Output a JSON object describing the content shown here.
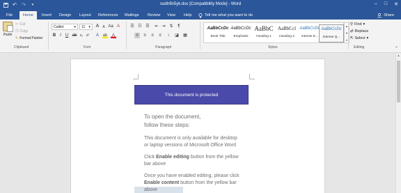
{
  "window": {
    "title": "sudtr8n5yk.doc [Compatibility Mode] - Word",
    "minimize_glyph": "–",
    "maximize_glyph": "□",
    "close_glyph": "✕"
  },
  "quick_access": {
    "save_icon": "save-icon",
    "undo_icon": "undo-icon",
    "redo_icon": "redo-icon"
  },
  "tabs": [
    "File",
    "Home",
    "Insert",
    "Design",
    "Layout",
    "References",
    "Mailings",
    "Review",
    "View",
    "Help"
  ],
  "active_tab": "Home",
  "tell_me": "Tell me what you want to do",
  "share": "Share",
  "clipboard": {
    "paste": "Paste",
    "cut": "Cut",
    "copy": "Copy",
    "format_painter": "Format Painter",
    "label": "Clipboard"
  },
  "font": {
    "name": "Calibri",
    "size": "11",
    "label": "Font"
  },
  "paragraph": {
    "label": "Paragraph"
  },
  "styles": {
    "label": "Styles",
    "items": [
      {
        "preview": "AaBbCcDc",
        "name": "Book Title"
      },
      {
        "preview": "AaBbCcDc",
        "name": "Emphasis"
      },
      {
        "preview": "AaBbC",
        "name": "Heading 1"
      },
      {
        "preview": "AaBbCcl",
        "name": "Heading 2"
      },
      {
        "preview": "AaBbCcDc",
        "name": "Intense E..."
      },
      {
        "preview": "AaBbCcDc",
        "name": "Intense Q..."
      }
    ]
  },
  "editing": {
    "find": "Find",
    "replace": "Replace",
    "select": "Select",
    "label": "Editing"
  },
  "document": {
    "banner": "This document is protected",
    "line1": "To open the document,",
    "line2": "follow these steps:",
    "p1a": "This document is only available for desktop",
    "p1b": "or laptop versions of Microsoft Office Word",
    "p2_pre": "Click ",
    "p2_bold": "Enable editing",
    "p2_post": " button from the yellow",
    "p2b": "bar above",
    "p3a": "Once you have enabled editing, please click",
    "p3_bold": "Enable content",
    "p3_post": " button from the yellow bar",
    "p3c": "above"
  },
  "colors": {
    "title_bar": "#2b579a",
    "banner": "#4a4aaa",
    "ribbon": "#f3f3f3"
  }
}
